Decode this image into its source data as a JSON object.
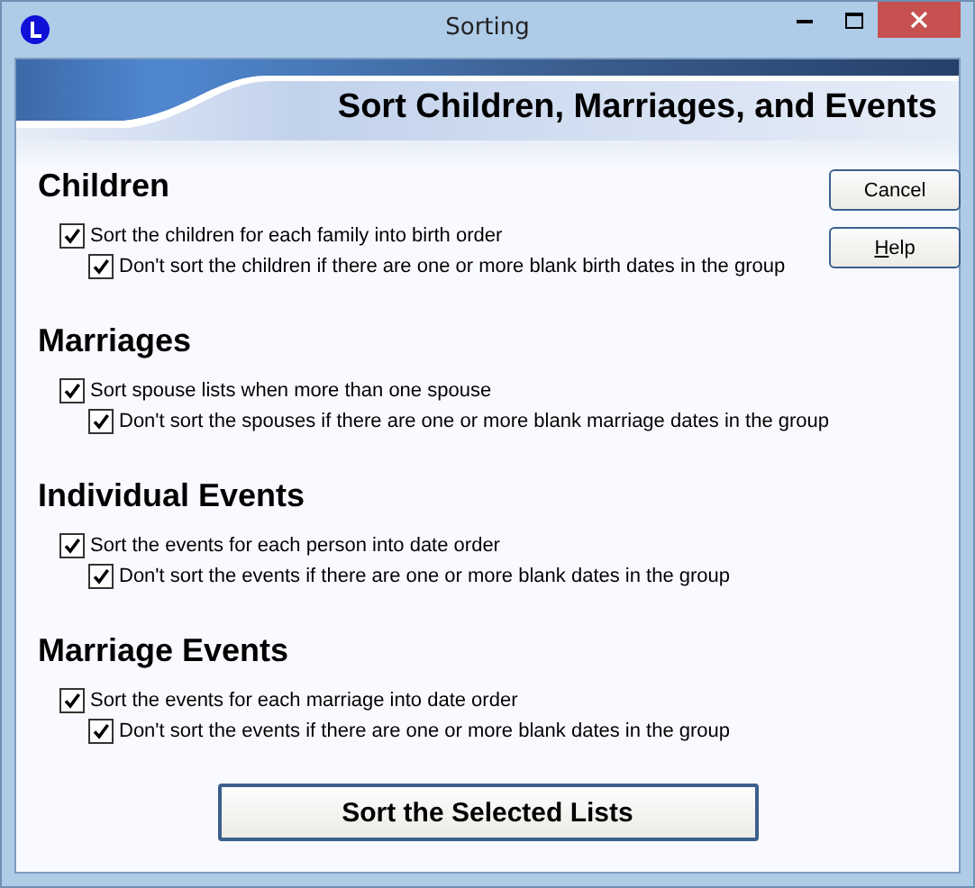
{
  "window": {
    "title": "Sorting"
  },
  "banner": {
    "title": "Sort Children, Marriages, and Events"
  },
  "sections": [
    {
      "heading": "Children",
      "option": {
        "label": "Sort the children for each family into birth order",
        "checked": true
      },
      "sub_option": {
        "label": "Don't sort the children if there are one or more blank birth dates in the group",
        "checked": true
      }
    },
    {
      "heading": "Marriages",
      "option": {
        "label": "Sort spouse lists when more than one spouse",
        "checked": true
      },
      "sub_option": {
        "label": "Don't sort the spouses if there are one or more blank marriage dates in the group",
        "checked": true
      }
    },
    {
      "heading": "Individual Events",
      "option": {
        "label": "Sort the events for each person into date order",
        "checked": true
      },
      "sub_option": {
        "label": "Don't sort the events if there are one or more blank dates in the group",
        "checked": true
      }
    },
    {
      "heading": "Marriage Events",
      "option": {
        "label": "Sort the events for each marriage into date order",
        "checked": true
      },
      "sub_option": {
        "label": "Don't sort the events if there are one or more blank dates in the group",
        "checked": true
      }
    }
  ],
  "side_buttons": [
    {
      "label": "Cancel"
    },
    {
      "label": "Help",
      "mnemonic_underlined": true
    }
  ],
  "primary_button": {
    "label": "Sort the Selected Lists"
  }
}
